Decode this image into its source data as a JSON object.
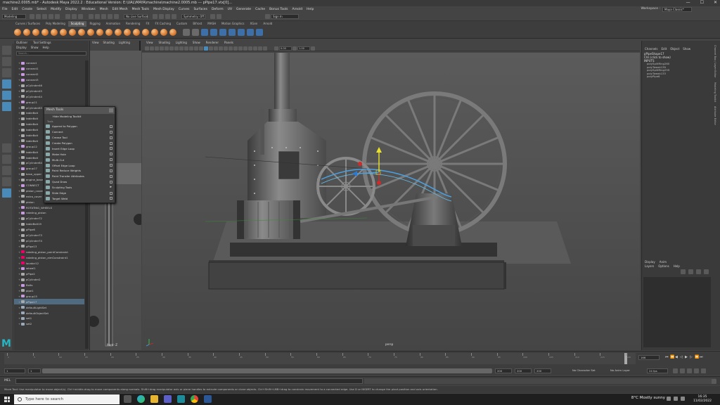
{
  "window": {
    "title": "machine2.0005.mb* - Autodesk Maya 2022.2 : Educational Version: E:\\UAL\\MAYA\\machine\\machine2.0005.mb   ---   pPipe17.vtx[0]...",
    "minimize": "—",
    "maximize": "☐",
    "close": "✕"
  },
  "menubar": {
    "items": [
      "File",
      "Edit",
      "Create",
      "Select",
      "Modify",
      "Display",
      "Windows",
      "Mesh",
      "Edit Mesh",
      "Mesh Tools",
      "Mesh Display",
      "Curves",
      "Surfaces",
      "Deform",
      "UV",
      "Generate",
      "Cache",
      "Bonus Tools",
      "Arnold",
      "Help"
    ],
    "workspace_label": "Workspace :",
    "workspace_value": "Maya Classic*"
  },
  "statusline": {
    "mode": "Modeling",
    "live_surface": "No Live Surface",
    "symmetry": "Symmetry: Off",
    "sign_in": "Sign In"
  },
  "shelf": {
    "tabs": [
      "Curves / Surfaces",
      "Poly Modeling",
      "Sculpting",
      "Rigging",
      "Animation",
      "Rendering",
      "FX",
      "FX Caching",
      "Custom",
      "Bifrost",
      "MASH",
      "Motion Graphics",
      "XGen",
      "Arnold"
    ],
    "active_tab": "Sculpting"
  },
  "outliner": {
    "tabs": [
      "Outliner",
      "Tool Settings"
    ],
    "menus": [
      "Display",
      "Show",
      "Help"
    ],
    "search_placeholder": "Search...",
    "items": [
      {
        "label": "connect",
        "type": "grp"
      },
      {
        "label": "connect1",
        "type": "grp"
      },
      {
        "label": "connect2",
        "type": "grp"
      },
      {
        "label": "connect3",
        "type": "grp"
      },
      {
        "label": "pCylinder46",
        "type": "mesh"
      },
      {
        "label": "pCylinder45",
        "type": "mesh"
      },
      {
        "label": "pCylinder44",
        "type": "mesh"
      },
      {
        "label": "group11",
        "type": "grp"
      },
      {
        "label": "pCylinder63",
        "type": "mesh"
      },
      {
        "label": "tableBolt",
        "type": "mesh"
      },
      {
        "label": "tableBolt",
        "type": "mesh"
      },
      {
        "label": "tableBolt",
        "type": "mesh"
      },
      {
        "label": "tableBolt",
        "type": "mesh"
      },
      {
        "label": "tableBolt",
        "type": "mesh"
      },
      {
        "label": "tableBolt",
        "type": "mesh"
      },
      {
        "label": "group12",
        "type": "grp"
      },
      {
        "label": "tableBolt",
        "type": "mesh"
      },
      {
        "label": "tableBolt",
        "type": "mesh"
      },
      {
        "label": "pCylinder64",
        "type": "mesh"
      },
      {
        "label": "group17",
        "type": "grp"
      },
      {
        "label": "base_upper",
        "type": "mesh"
      },
      {
        "label": "engine_base",
        "type": "mesh"
      },
      {
        "label": "CONNECT",
        "type": "grp"
      },
      {
        "label": "piston_cover",
        "type": "mesh"
      },
      {
        "label": "extra_cover",
        "type": "mesh"
      },
      {
        "label": "piston",
        "type": "mesh"
      },
      {
        "label": "ROTATING_WHEELS",
        "type": "grp"
      },
      {
        "label": "rotating_piston",
        "type": "grp"
      },
      {
        "label": "pCylinder72",
        "type": "mesh"
      },
      {
        "label": "tableBolt19",
        "type": "mesh"
      },
      {
        "label": "pPipe6",
        "type": "mesh"
      },
      {
        "label": "pCylinder73",
        "type": "mesh"
      },
      {
        "label": "pCylinder74",
        "type": "mesh"
      },
      {
        "label": "pPipe13",
        "type": "mesh"
      },
      {
        "label": "rotating_piston_pointConstraint",
        "type": "loc"
      },
      {
        "label": "rotating_piston_aimConstraint1",
        "type": "loc"
      },
      {
        "label": "locator12",
        "type": "loc"
      },
      {
        "label": "wheel1",
        "type": "grp"
      },
      {
        "label": "pPipe2",
        "type": "mesh"
      },
      {
        "label": "pCylinder2",
        "type": "mesh"
      },
      {
        "label": "Bolts",
        "type": "grp"
      },
      {
        "label": "pipe1",
        "type": "mesh"
      },
      {
        "label": "group15",
        "type": "grp"
      },
      {
        "label": "pPipe17",
        "type": "mesh",
        "selected": true
      },
      {
        "label": "defaultLightSet",
        "type": "set"
      },
      {
        "label": "defaultObjectSet",
        "type": "set"
      },
      {
        "label": "set1",
        "type": "set"
      },
      {
        "label": "set2",
        "type": "set"
      }
    ]
  },
  "panels": {
    "side_menus": [
      "View",
      "Shading",
      "Lighting"
    ],
    "side_label": "front -Z",
    "main_menus": [
      "View",
      "Shading",
      "Lighting",
      "Show",
      "Renderer",
      "Panels"
    ],
    "main_label": "persp",
    "main_exposure": "0.00",
    "main_gamma": "1.00"
  },
  "mesh_tools_menu": {
    "title": "Mesh Tools",
    "hide_toolkit": "Hide Modeling Toolkit",
    "section": "Tools",
    "items": [
      {
        "label": "Append to Polygon",
        "box": true
      },
      {
        "label": "Connect",
        "box": true
      },
      {
        "label": "Crease Tool",
        "box": true
      },
      {
        "label": "Create Polygon",
        "box": true
      },
      {
        "label": "Insert Edge Loop",
        "box": true
      },
      {
        "label": "Make Hole",
        "box": true
      },
      {
        "label": "Multi-Cut",
        "box": true
      },
      {
        "label": "Offset Edge Loop",
        "box": true
      },
      {
        "label": "Paint Reduce Weights",
        "box": true
      },
      {
        "label": "Paint Transfer Attributes",
        "box": true
      },
      {
        "label": "Quad Draw",
        "box": true
      },
      {
        "label": "Sculpting Tools",
        "submenu": true
      },
      {
        "label": "Slide Edge",
        "box": true
      },
      {
        "label": "Target Weld",
        "box": true
      }
    ]
  },
  "channel_box": {
    "menus": [
      "Channels",
      "Edit",
      "Object",
      "Show"
    ],
    "object": "pPipeShape17",
    "cvs": "CVs (click to show)",
    "inputs_label": "INPUTS",
    "inputs": [
      "polySplitRing260",
      "polyTweak139",
      "polySplitRing259",
      "polyTweak133",
      "polyPipe6"
    ],
    "layer_tabs": [
      "Display",
      "Anim"
    ],
    "layer_menus": [
      "Layers",
      "Options",
      "Help"
    ]
  },
  "right_tabs": [
    "Channel Box / Layer Editor",
    "Modeling Toolkit",
    "Attribute Editor"
  ],
  "timeslider": {
    "ticks": [
      "1",
      "5",
      "10",
      "15",
      "20",
      "25",
      "30",
      "35",
      "40",
      "45",
      "50",
      "55",
      "60",
      "65",
      "70",
      "75",
      "80",
      "85",
      "90",
      "95",
      "100",
      "105",
      "110",
      "115",
      "120"
    ],
    "current_frame": "166"
  },
  "rangeslider": {
    "start": "1",
    "inner_start": "1",
    "inner_end": "200",
    "end": "200",
    "end2": "200",
    "character_set": "No Character Set",
    "anim_layer": "No Anim Layer",
    "fps": "24 fps"
  },
  "cmdline": {
    "label": "MEL"
  },
  "helpline": {
    "text": "Move Tool: Use manipulator to move object(s). Ctrl+middle-drag to move components along normals. Shift+drag manipulator axis or plane handles to extrude components or clone objects. Ctrl+Shift+LMB+drag to constrain movement to a connected edge. Use D or INSERT to change the pivot position and axis orientation."
  },
  "taskbar": {
    "search_placeholder": "Type here to search",
    "weather": "8°C  Mostly sunny",
    "time": "16:35",
    "date": "11/02/2022"
  },
  "colors": {
    "accent": "#4a8ab8",
    "maya_logo": "#25b5c3",
    "selection_green": "#2ae04a",
    "selection_blue": "#4aa0e0"
  }
}
